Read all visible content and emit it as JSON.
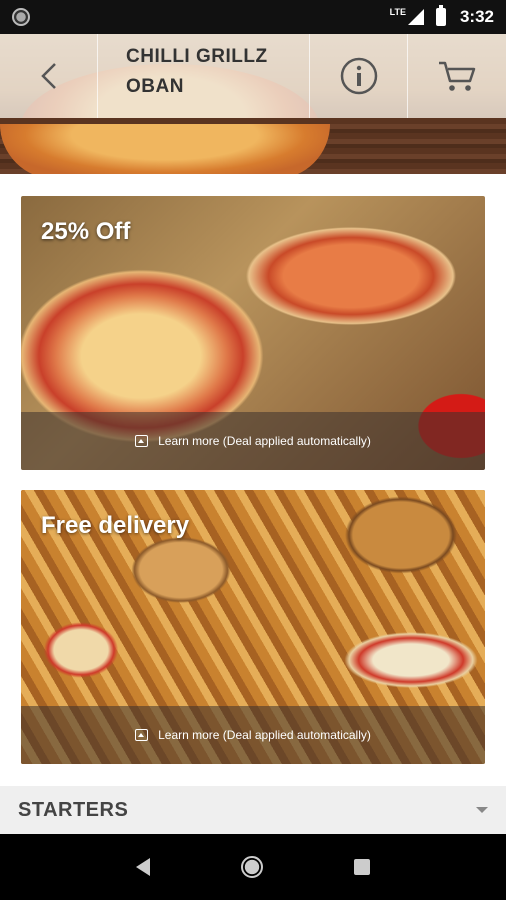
{
  "status_bar": {
    "network": "LTE",
    "time": "3:32"
  },
  "header": {
    "title_line1": "CHILLI GRILLZ",
    "title_line2": "OBAN",
    "icons": [
      "back-arrow-icon",
      "info-icon",
      "cart-icon"
    ]
  },
  "deals": [
    {
      "title": "25% Off",
      "footer": "Learn more (Deal applied automatically)"
    },
    {
      "title": "Free delivery",
      "footer": "Learn more (Deal applied automatically)"
    }
  ],
  "menu_section": {
    "label": "STARTERS"
  },
  "navigation": {
    "icons": [
      "nav-back-icon",
      "nav-home-icon",
      "nav-recents-icon"
    ]
  },
  "colors": {
    "header_overlay": "#f0ebe4",
    "deal_footer": "#3c322d",
    "section_bg": "#efefef"
  }
}
